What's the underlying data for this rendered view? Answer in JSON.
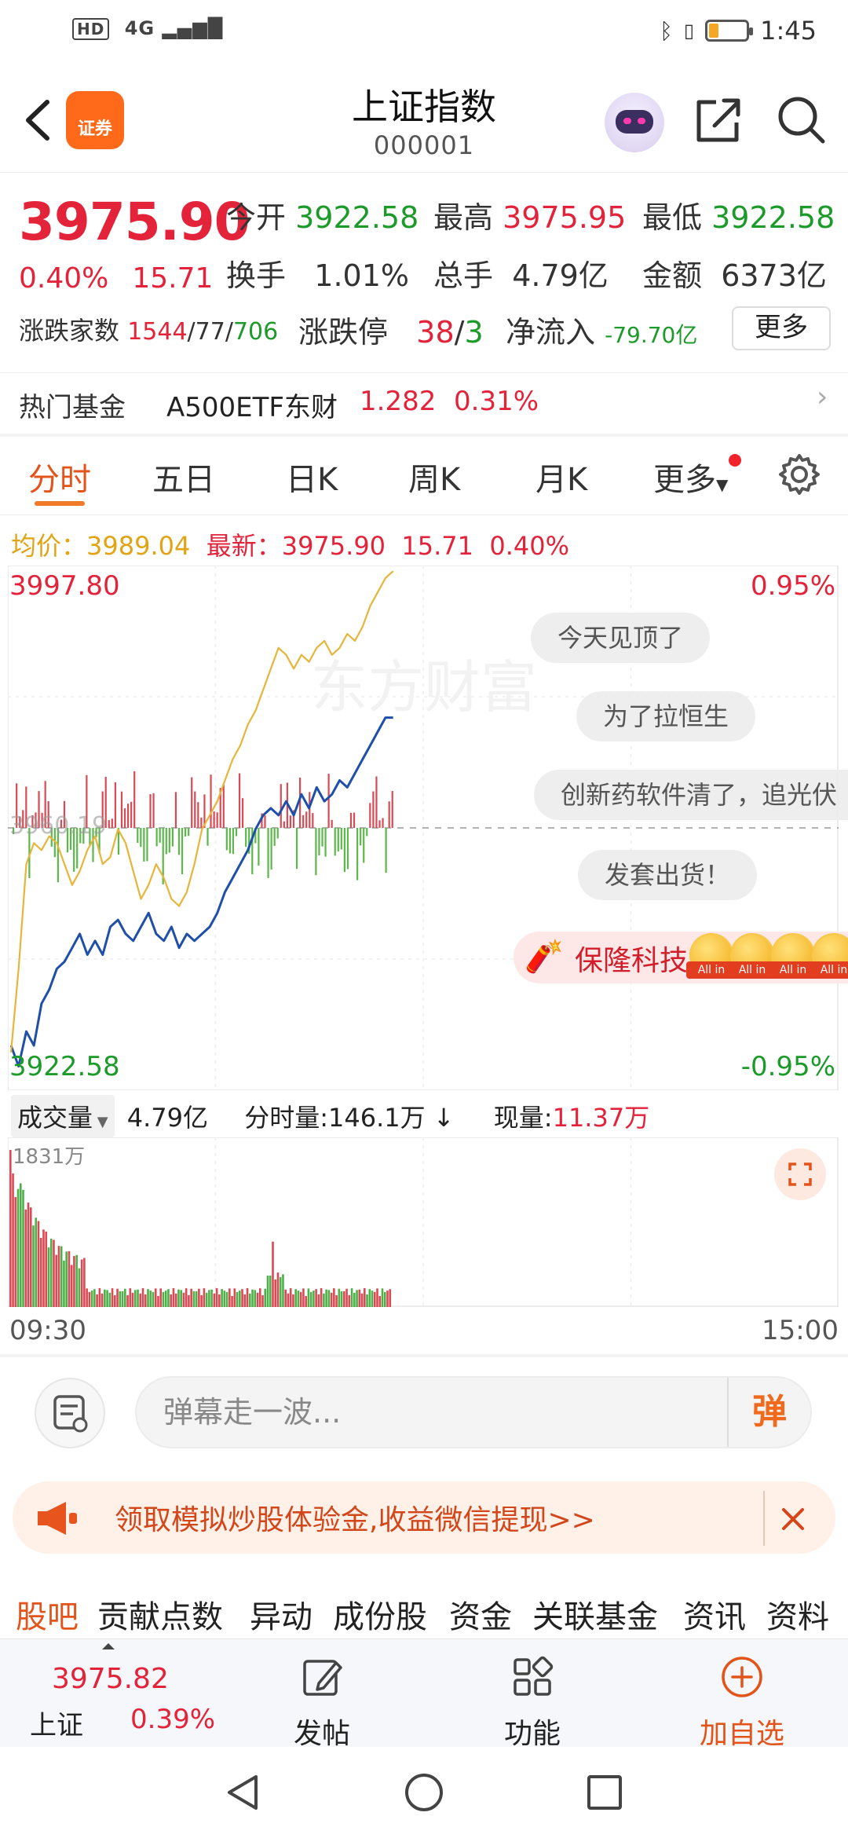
{
  "status_bar": {
    "hd": "HD",
    "network": "4G",
    "time": "1:45",
    "battery_fraction": 0.25
  },
  "header": {
    "logo_text": "证券",
    "title": "上证指数",
    "code": "000001"
  },
  "quote": {
    "price": "3975.90",
    "change_pct": "0.40%",
    "change_pts": "15.71",
    "open_label": "今开",
    "open_value": "3922.58",
    "high_label": "最高",
    "high_value": "3975.95",
    "low_label": "最低",
    "low_value": "3922.58",
    "turnover_label": "换手",
    "turnover_value": "1.01%",
    "volume_label": "总手",
    "volume_value": "4.79亿",
    "amount_label": "金额",
    "amount_value": "6373亿",
    "breadth_label": "涨跌家数",
    "breadth_up": "1544",
    "breadth_flat": "77",
    "breadth_down": "706",
    "limit_label": "涨跌停",
    "limit_up": "38",
    "limit_down": "3",
    "netflow_label": "净流入",
    "netflow_value": "-79.70亿",
    "more_label": "更多"
  },
  "hot_fund": {
    "label": "热门基金",
    "name": "A500ETF东财",
    "price": "1.282",
    "pct": "0.31%"
  },
  "tabs": [
    {
      "label": "分时",
      "active": true
    },
    {
      "label": "五日"
    },
    {
      "label": "日K"
    },
    {
      "label": "周K"
    },
    {
      "label": "月K"
    },
    {
      "label": "更多"
    }
  ],
  "avg_line": {
    "avg_label": "均价：",
    "avg_value": "3989.04",
    "latest_label": "最新：",
    "latest_value": "3975.90",
    "chg": "15.71",
    "pct": "0.40%"
  },
  "chart_data": {
    "type": "line",
    "y_top": "3997.80",
    "y_bottom": "3922.58",
    "pct_top": "0.95%",
    "pct_bottom": "-0.95%",
    "prev_close_label": "3960.19",
    "ylim": [
      3922.58,
      3997.8
    ],
    "x_start": "09:30",
    "x_end": "15:00",
    "series": [
      {
        "color": "#1f4fa8",
        "values": [
          3929,
          3926,
          3931,
          3929,
          3935,
          3937,
          3940,
          3941,
          3943,
          3945,
          3942,
          3944,
          3942,
          3946,
          3947,
          3945,
          3944,
          3946,
          3948,
          3945,
          3944,
          3946,
          3943,
          3945,
          3944,
          3945,
          3946,
          3948,
          3951,
          3953,
          3955,
          3957,
          3960,
          3962,
          3963,
          3962,
          3964,
          3962,
          3965,
          3963,
          3966,
          3964,
          3965,
          3967,
          3966,
          3968,
          3970,
          3972,
          3974,
          3976,
          3976
        ]
      },
      {
        "color": "#e6b53a",
        "values": [
          3928,
          3940,
          3955,
          3958,
          3957,
          3959,
          3958,
          3955,
          3952,
          3954,
          3957,
          3959,
          3955,
          3956,
          3960,
          3958,
          3954,
          3950,
          3952,
          3955,
          3953,
          3950,
          3949,
          3951,
          3955,
          3960,
          3962,
          3964,
          3967,
          3970,
          3972,
          3975,
          3977,
          3980,
          3983,
          3986,
          3985,
          3983,
          3985,
          3984,
          3986,
          3987,
          3985,
          3986,
          3988,
          3987,
          3989,
          3992,
          3994,
          3996,
          3997
        ]
      }
    ],
    "danmaku": [
      "今天见顶了",
      "为了拉恒生",
      "创新药软件清了，追光伏",
      "发套出货！"
    ],
    "promo": "保隆科技",
    "coin_tag": "All in"
  },
  "volume": {
    "selector": "成交量",
    "total": "4.79亿",
    "minute_label": "分时量:",
    "minute_value": "146.1万",
    "current_label": "现量:",
    "current_value": "11.37万",
    "max_label": "1831万"
  },
  "danmu_input": {
    "placeholder": "弹幕走一波...",
    "send_label": "弹"
  },
  "banner": {
    "text": "领取模拟炒股体验金,收益微信提现>>"
  },
  "subtabs": [
    "股吧",
    "贡献点数",
    "异动",
    "成份股",
    "资金",
    "关联基金",
    "资讯",
    "资料"
  ],
  "footer": {
    "index_price": "3975.82",
    "index_name": "上证",
    "index_pct": "0.39%",
    "post_label": "发帖",
    "func_label": "功能",
    "add_label": "加自选"
  },
  "colors": {
    "up": "#e2233a",
    "down": "#1c9a2a",
    "accent": "#f07a2a",
    "avg": "#e0a414"
  }
}
